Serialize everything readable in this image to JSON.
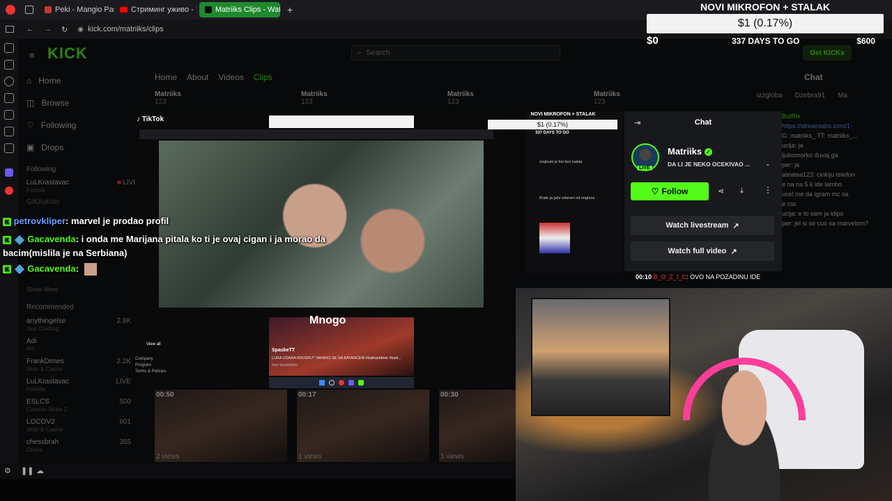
{
  "browser": {
    "tabs": [
      {
        "label": "Peki - Mangio Pasta feat. G"
      },
      {
        "label": "Стриминг уживо - YouTub"
      },
      {
        "label": "Matriiks Clips - Watch Live"
      }
    ],
    "url": "kick.com/matriiks/clips",
    "new_tab": "+"
  },
  "goal": {
    "title": "NOVI MIKROFON + STALAK",
    "amount": "$1 (0.17%)",
    "min": "$0",
    "days": "337 DAYS TO GO",
    "max": "$600"
  },
  "kick": {
    "logo": "KICK",
    "search_placeholder": "Search",
    "nav": [
      "Home",
      "Browse",
      "Following",
      "Drops"
    ],
    "following_header": "Following",
    "show_more": "Show More",
    "recommended_header": "Recommended",
    "following": [
      {
        "name": "LuLKrastavac",
        "sub": "Fortnite",
        "status": "LIVE"
      },
      {
        "name": "GitDluKiler",
        "sub": "",
        "status": ""
      }
    ],
    "recommended": [
      {
        "name": "anythingelse",
        "sub": "Just Chatting",
        "viewers": "2.9K"
      },
      {
        "name": "Adi",
        "sub": "IRL",
        "viewers": ""
      },
      {
        "name": "FrankDimes",
        "sub": "Slots & Casino",
        "viewers": "2.2K"
      },
      {
        "name": "LuLKrastavac",
        "sub": "Fortnite",
        "viewers": "LIVE"
      },
      {
        "name": "ESLCS",
        "sub": "Counter-Strike 2",
        "viewers": "500"
      },
      {
        "name": "LOCOV2",
        "sub": "Slots & Casino",
        "viewers": "601"
      },
      {
        "name": "chessbrah",
        "sub": "Chess",
        "viewers": "355"
      }
    ],
    "channel_tabs": [
      "Home",
      "About",
      "Videos",
      "Clips"
    ],
    "clip_cards": [
      {
        "name": "Matriiks",
        "count": "123"
      },
      {
        "name": "Matriiks",
        "count": "123"
      },
      {
        "name": "Matriiks",
        "count": "123"
      },
      {
        "name": "Matriiks",
        "count": "123"
      }
    ],
    "get_kicks": "Get KICKs",
    "chat_header": "Chat",
    "chat_users": [
      "izzgloba",
      "Dzebra91",
      "Ma"
    ],
    "clips": [
      {
        "time": "00:50",
        "views": "2 views"
      },
      {
        "time": "00:17",
        "views": "1 views"
      },
      {
        "time": "00:30",
        "views": "1 views"
      }
    ]
  },
  "overlay_chat": [
    {
      "user": "petrovkliper",
      "text": ": marvel je prodao profil"
    },
    {
      "user": "Gacavenda",
      "text": ": i onda me Marijana pitala ko ti je ovaj cigan i ja morao da bacim(mislila je na Serbiana)"
    },
    {
      "user": "Gacavenda",
      "text": ":"
    }
  ],
  "tiktok": {
    "logo": "TikTok",
    "footer_links": [
      "Company",
      "Program",
      "Terms & Policies"
    ],
    "view_all": "View all",
    "video_caption_user": "SpaskeTT",
    "video_caption": "LUKA UDARA KRUSKU* TAKMICI SE SA BATANCEM #balkantiktok #balk...",
    "see_translation": "See translation",
    "big_text": "Mnogo",
    "comments": [
      "engleski je bio bez zaleta",
      "Brate ja jače udaram od engleza"
    ],
    "mini_goal_title": "NOVI MIKROFON + STALAK",
    "mini_goal_amount": "$1 (0.17%)",
    "mini_goal_days": "337 DAYS TO GO"
  },
  "channel_panel": {
    "header": "Chat",
    "name": "Matriiks",
    "title": "DA LI JE NEKO OCEKIVAO ...",
    "live": "LIVE",
    "follow": "Follow",
    "watch_live": "Watch livestream",
    "watch_full": "Watch full video",
    "caption_time": "00:10",
    "caption_user": "B_O_Z_I_C",
    "caption_text": ": OVO NA POZADINU IDE"
  },
  "side_chat_snippets": [
    "BotRix",
    "https://streamlabs.com/1-",
    "G: matriiks_ TT: matriiks_...",
    "ucija: ja",
    "ljubomorko duvaj ga",
    "per: ja",
    "ateatea123: cinkiju telefon",
    "e na na 5 k ide lambo",
    "ucel me da igram mc sa",
    "e csc",
    "ucija: e to sam ja klipo",
    "per: jel si se cuo sa marvelom?"
  ],
  "colors": {
    "kick_green": "#53fc18",
    "username_blue": "#6f9bff"
  }
}
